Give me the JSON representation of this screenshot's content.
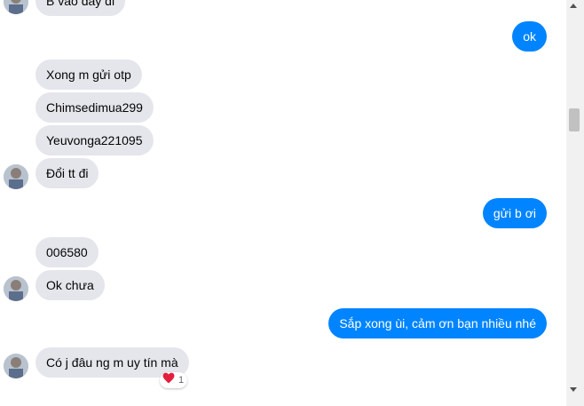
{
  "messages": [
    {
      "from": "them",
      "text": "B vào đây đi"
    },
    {
      "from": "me",
      "text": "ok"
    },
    {
      "from": "them",
      "text": "Xong m gửi otp"
    },
    {
      "from": "them",
      "text": "Chimsedimua299"
    },
    {
      "from": "them",
      "text": "Yeuvonga221095"
    },
    {
      "from": "them",
      "text": "Đổi tt đi"
    },
    {
      "from": "me",
      "text": "gửi b ơi"
    },
    {
      "from": "them",
      "text": "006580"
    },
    {
      "from": "them",
      "text": "Ok chưa"
    },
    {
      "from": "me",
      "text": "Sắp xong ùi, cảm ơn bạn nhiều nhé"
    },
    {
      "from": "them",
      "text": "Có j đâu ng m uy tín mà",
      "reaction": {
        "icon": "heart-icon",
        "count": "1"
      }
    }
  ],
  "colors": {
    "outgoing": "#0084ff",
    "incoming": "#e4e6eb",
    "heart": "#e41e3f"
  }
}
